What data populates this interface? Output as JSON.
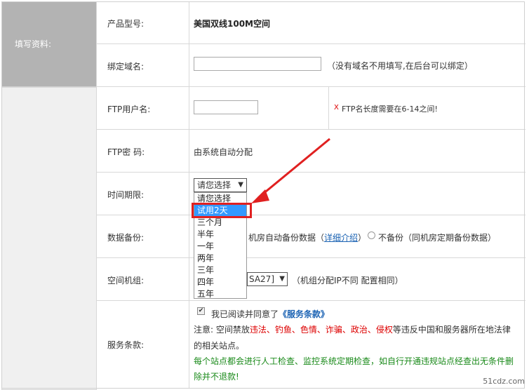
{
  "section_label": "填写资料:",
  "rows": {
    "product": {
      "label": "产品型号:",
      "value": "美国双线100M空间"
    },
    "domain": {
      "label": "绑定域名:",
      "input_value": "",
      "hint": "（没有域名不用填写,在后台可以绑定）"
    },
    "ftp_user": {
      "label": "FTP用户名:",
      "input_value": "",
      "error_mark": "X",
      "hint": "FTP名长度需要在6-14之间!"
    },
    "ftp_pass": {
      "label": "FTP密  码:",
      "value": "由系统自动分配"
    },
    "period": {
      "label": "时间期限:",
      "selected": "请您选择",
      "options": [
        "请您选择",
        "试用2天",
        "三个月",
        "半年",
        "一年",
        "两年",
        "三年",
        "四年",
        "五年"
      ],
      "highlighted_option": "试用2天"
    },
    "backup": {
      "label": "数据备份:",
      "option1_tail": "机房自动备份数据（",
      "option1_link": "详细介绍",
      "option1_end": "）",
      "option2": "不备份（同机房定期备份数据）"
    },
    "server_group": {
      "label": "空间机组:",
      "select_tail": "SA27]",
      "hint": "（机组分配IP不同 配置相同）"
    },
    "terms": {
      "label": "服务条款:",
      "agree_text": "我已阅读并同意了",
      "terms_link": "《服务条款》",
      "note_prefix": "注意: 空间禁放",
      "note_red": "违法、钓鱼、色情、诈骗、政治、侵权",
      "note_suffix": "等违反中国和服务器所在地法律",
      "note_line2": "的相关站点。",
      "green_line1": "每个站点都会进行人工检查、监控系统定期检查，如自行开通违规站点经查出无条件删",
      "green_line2": "除并不退款!"
    }
  },
  "watermark": "51cdz.com",
  "colors": {
    "highlight": "#e02020",
    "link": "#1a62b3",
    "selected_option": "#3399ff",
    "green_note": "#1a8a1a"
  }
}
